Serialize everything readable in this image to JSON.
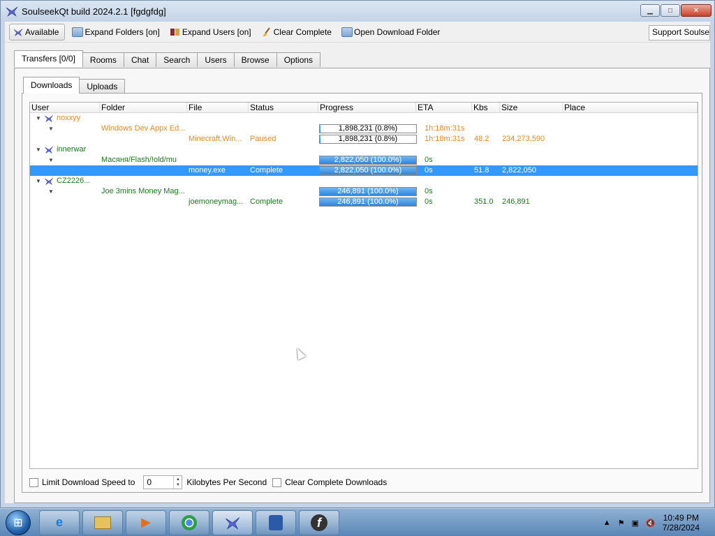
{
  "window": {
    "title": "SoulseekQt build 2024.2.1 [fgdgfdg]",
    "minimize": "▁",
    "maximize": "□",
    "close": "✕"
  },
  "toolbar": {
    "available": "Available",
    "expand_folders": "Expand Folders [on]",
    "expand_users": "Expand Users [on]",
    "clear_complete": "Clear Complete",
    "open_download_folder": "Open Download Folder",
    "support": "Support Soulseek"
  },
  "tabs": [
    "Transfers [0/0]",
    "Rooms",
    "Chat",
    "Search",
    "Users",
    "Browse",
    "Options"
  ],
  "subtabs": [
    "Downloads",
    "Uploads"
  ],
  "columns": [
    "User",
    "Folder",
    "File",
    "Status",
    "Progress",
    "ETA",
    "Kbs",
    "Size",
    "Place"
  ],
  "rows": [
    {
      "type": "user",
      "user": "noxxyy",
      "color": "orange"
    },
    {
      "type": "folder",
      "folder": "Windows Dev Appx Ed...",
      "progress": "1,898,231 (0.8%)",
      "fill": 0.008,
      "eta": "1h:18m:31s",
      "color": "orange"
    },
    {
      "type": "file",
      "file": "Minecraft.Win...",
      "status": "Paused",
      "progress": "1,898,231 (0.8%)",
      "fill": 0.008,
      "eta": "1h:18m:31s",
      "kbs": "48.2",
      "size": "234,273,590",
      "color": "orange"
    },
    {
      "type": "user",
      "user": "innerwar",
      "color": "green"
    },
    {
      "type": "folder",
      "folder": "Масяня/Flash/!old/mu",
      "progress": "2,822,050 (100.0%)",
      "fill": 1.0,
      "eta": "0s",
      "color": "green"
    },
    {
      "type": "file",
      "file": "money.exe",
      "status": "Complete",
      "progress": "2,822,050 (100.0%)",
      "fill": 1.0,
      "eta": "0s",
      "kbs": "51.8",
      "size": "2,822,050",
      "color": "green",
      "selected": true
    },
    {
      "type": "user",
      "user": "CZ2226...",
      "color": "green"
    },
    {
      "type": "folder",
      "folder": "Joe 3mins Money Mag...",
      "progress": "246,891 (100.0%)",
      "fill": 1.0,
      "eta": "0s",
      "color": "green"
    },
    {
      "type": "file",
      "file": "joemoneymag...",
      "status": "Complete",
      "progress": "246,891 (100.0%)",
      "fill": 1.0,
      "eta": "0s",
      "kbs": "351.0",
      "size": "246,891",
      "color": "green"
    }
  ],
  "bottom": {
    "limit_label": "Limit Download Speed to",
    "limit_value": "0",
    "unit_label": "Kilobytes Per Second",
    "clear_label": "Clear Complete Downloads"
  },
  "taskbar": {
    "apps": [
      "internet-explorer-icon",
      "file-explorer-icon",
      "media-player-icon",
      "chrome-icon",
      "soulseek-icon",
      "app-icon",
      "flash-icon"
    ],
    "time": "10:49 PM",
    "date": "7/28/2024"
  }
}
